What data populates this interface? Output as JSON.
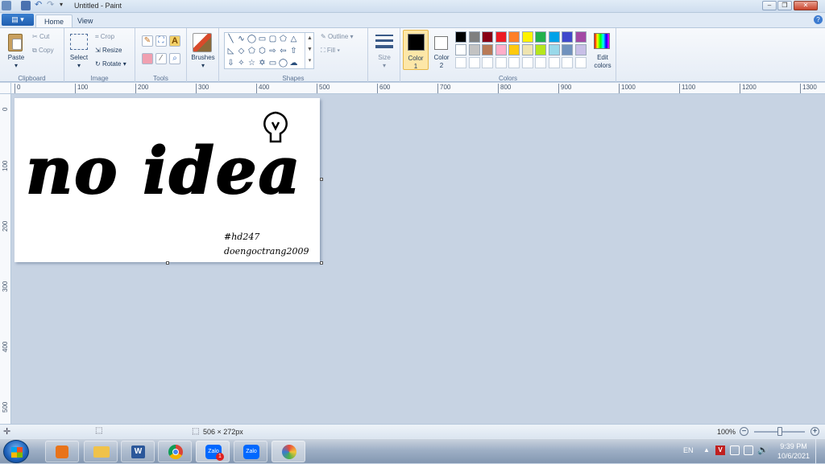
{
  "window": {
    "title": "Untitled - Paint"
  },
  "tabs": {
    "file_label": "▤ ▾",
    "home": "Home",
    "view": "View"
  },
  "help": "?",
  "clipboard": {
    "paste": "Paste",
    "cut": "Cut",
    "copy": "Copy",
    "group": "Clipboard"
  },
  "image": {
    "select": "Select",
    "crop": "Crop",
    "resize": "Resize",
    "rotate": "Rotate",
    "group": "Image"
  },
  "tools": {
    "group": "Tools"
  },
  "brushes": {
    "label": "Brushes"
  },
  "shapes": {
    "outline": "Outline",
    "fill": "Fill",
    "group": "Shapes"
  },
  "size": {
    "label": "Size"
  },
  "colors": {
    "color1_a": "Color",
    "color1_b": "1",
    "color2_a": "Color",
    "color2_b": "2",
    "edit_a": "Edit",
    "edit_b": "colors",
    "group": "Colors",
    "color1_value": "#000000",
    "color2_value": "#ffffff",
    "row1": [
      "#000000",
      "#7f7f7f",
      "#880015",
      "#ed1c24",
      "#ff7f27",
      "#fff200",
      "#22b14c",
      "#00a2e8",
      "#3f48cc",
      "#a349a4"
    ],
    "row2": [
      "#ffffff",
      "#c3c3c3",
      "#b97a57",
      "#ffaec9",
      "#ffc90e",
      "#efe4b0",
      "#b5e61d",
      "#99d9ea",
      "#7092be",
      "#c8bfe7"
    ]
  },
  "ruler": {
    "h": [
      "0",
      "100",
      "200",
      "300",
      "400",
      "500",
      "600",
      "700",
      "800",
      "900",
      "1000",
      "1100",
      "1200",
      "1300"
    ],
    "v": [
      "0",
      "100",
      "200",
      "300",
      "400",
      "500"
    ]
  },
  "artwork": {
    "text": "no idea",
    "hashtag": "#hd247",
    "signature": "doengoctrang2009"
  },
  "status": {
    "dimensions": "506 × 272px",
    "zoom": "100%"
  },
  "taskbar": {
    "zalo_label": "Zalo",
    "zalo_badge": "1",
    "lang": "EN",
    "time": "9:39 PM",
    "date": "10/6/2021"
  }
}
